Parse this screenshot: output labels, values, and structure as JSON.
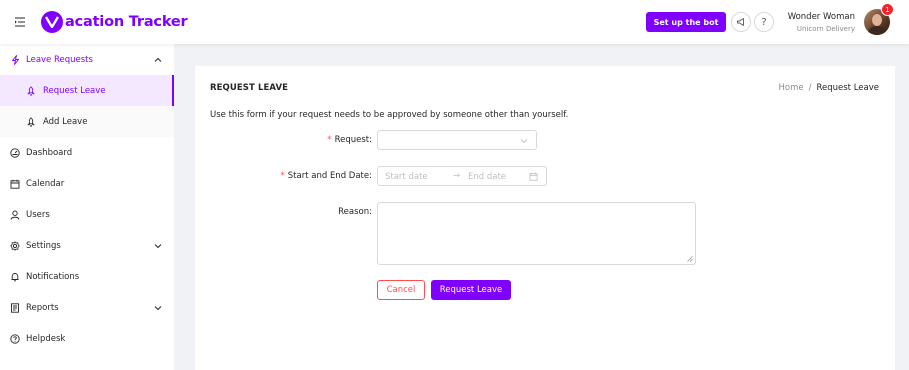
{
  "header": {
    "logo_text": "acation Tracker",
    "logo_initial": "V",
    "bot_button": "Set up the bot",
    "help_glyph": "?",
    "user_name": "Wonder Woman",
    "user_company": "Unicorn Delivery",
    "notification_count": "1",
    "brand_color": "#7f00ff"
  },
  "sidebar": {
    "group": {
      "label": "Leave Requests",
      "icon": "lightning-icon",
      "expanded": true
    },
    "subitems": [
      {
        "label": "Request Leave",
        "icon": "rocket-icon",
        "active": true
      },
      {
        "label": "Add Leave",
        "icon": "rocket-icon",
        "active": false
      }
    ],
    "items": [
      {
        "label": "Dashboard",
        "icon": "dashboard-icon"
      },
      {
        "label": "Calendar",
        "icon": "calendar-icon"
      },
      {
        "label": "Users",
        "icon": "user-icon"
      },
      {
        "label": "Settings",
        "icon": "gear-icon"
      },
      {
        "label": "Notifications",
        "icon": "bell-icon"
      },
      {
        "label": "Reports",
        "icon": "report-icon"
      },
      {
        "label": "Helpdesk",
        "icon": "question-icon"
      }
    ]
  },
  "page": {
    "title": "REQUEST LEAVE",
    "breadcrumb": {
      "home": "Home",
      "separator": "/",
      "current": "Request Leave"
    },
    "intro": "Use this form if your request needs to be approved by someone other than yourself."
  },
  "form": {
    "request_label": "Request",
    "dates_label": "Start and End Date",
    "reason_label": "Reason",
    "required_mark": "*",
    "label_colon": ":",
    "start_placeholder": "Start date",
    "end_placeholder": "End date",
    "range_separator": "→",
    "cancel_button": "Cancel",
    "submit_button": "Request Leave"
  }
}
